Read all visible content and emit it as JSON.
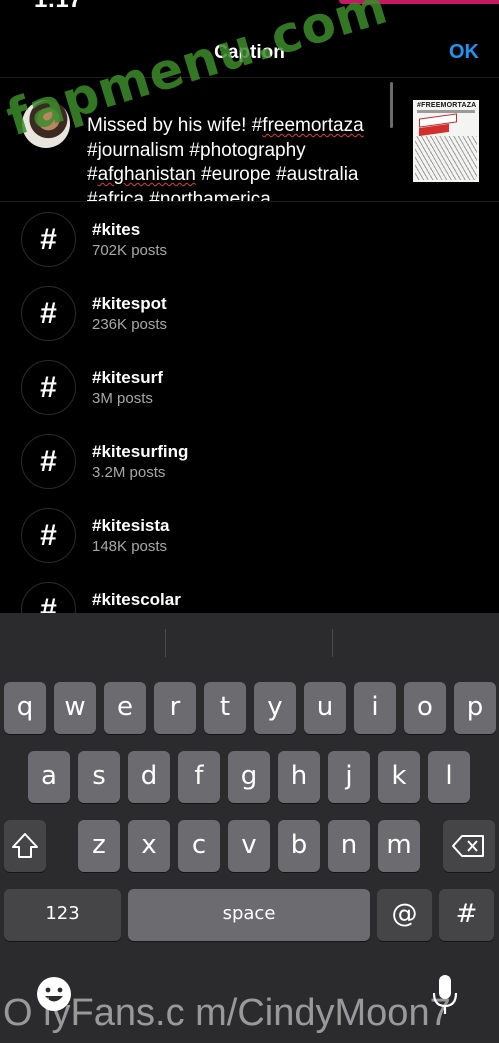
{
  "status_bar": {
    "time": "1:17"
  },
  "nav": {
    "title": "Caption",
    "ok_label": "OK"
  },
  "caption": {
    "segments": [
      {
        "text": "Missed by his wife! #",
        "squiggle": false
      },
      {
        "text": "freemortaza",
        "squiggle": true
      },
      {
        "text": " #journalism #photography #",
        "squiggle": false
      },
      {
        "text": "afghanistan",
        "squiggle": true
      },
      {
        "text": " #europe #australia #africa #northamerica",
        "squiggle": false
      }
    ]
  },
  "thumbnail": {
    "title": "#FREEMORTAZA"
  },
  "hashtag_suggestions": [
    {
      "symbol": "#",
      "name": "#kites",
      "posts": "702K posts"
    },
    {
      "symbol": "#",
      "name": "#kitespot",
      "posts": "236K posts"
    },
    {
      "symbol": "#",
      "name": "#kitesurf",
      "posts": "3M posts"
    },
    {
      "symbol": "#",
      "name": "#kitesurfing",
      "posts": "3.2M posts"
    },
    {
      "symbol": "#",
      "name": "#kitesista",
      "posts": "148K posts"
    },
    {
      "symbol": "#",
      "name": "#kitescolar",
      "posts": ""
    }
  ],
  "keyboard": {
    "row1": [
      "q",
      "w",
      "e",
      "r",
      "t",
      "y",
      "u",
      "i",
      "o",
      "p"
    ],
    "row2": [
      "a",
      "s",
      "d",
      "f",
      "g",
      "h",
      "j",
      "k",
      "l"
    ],
    "row3": [
      "z",
      "x",
      "c",
      "v",
      "b",
      "n",
      "m"
    ],
    "numbers_label": "123",
    "space_label": "space",
    "at_label": "@",
    "hash_label": "#"
  },
  "overlays": {
    "watermark": "fapmenu.com",
    "footer_text": "O lyFans.c m/CindyMoon7"
  },
  "colors": {
    "accent": "#1f94f0",
    "background": "#000000",
    "keyboard_bg": "#2b2b2d",
    "key_light": "#6c6c70",
    "key_dark": "#454548",
    "watermark": "#3c8c2c"
  }
}
